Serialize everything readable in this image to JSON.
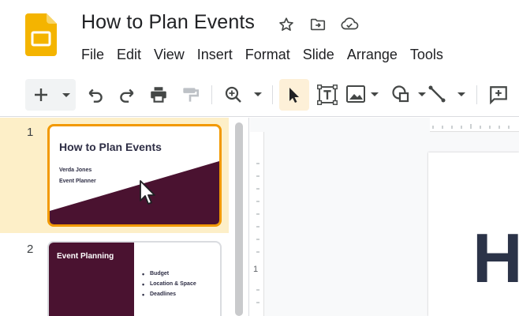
{
  "app": {
    "doc_title": "How to Plan Events",
    "menu": [
      "File",
      "Edit",
      "View",
      "Insert",
      "Format",
      "Slide",
      "Arrange",
      "Tools"
    ],
    "title_icons": [
      "star-icon",
      "move-to-folder-icon",
      "cloud-saved-icon"
    ],
    "brand_color": "#f4b400"
  },
  "toolbar": {
    "tools": [
      "new-slide-button",
      "new-slide-dropdown",
      "undo-button",
      "redo-button",
      "print-button",
      "paint-format-button",
      "zoom-button",
      "zoom-dropdown",
      "select-tool-button",
      "text-box-button",
      "image-button",
      "image-dropdown",
      "shape-button",
      "shape-dropdown",
      "line-button",
      "line-dropdown",
      "add-comment-button"
    ],
    "active_tool": "select-tool-button"
  },
  "filmstrip": {
    "slides": [
      {
        "number": "1",
        "title": "How to Plan Events",
        "lines": [
          "Verda Jones",
          "Event Planner"
        ],
        "selected": true,
        "accent_color": "#4a1230"
      },
      {
        "number": "2",
        "title": "Event Planning",
        "bullets": [
          "Budget",
          "Location & Space",
          "Deadlines"
        ],
        "selected": false,
        "accent_color": "#4a1230"
      }
    ]
  },
  "editor": {
    "ruler_label": "1",
    "slide_text": "H"
  }
}
